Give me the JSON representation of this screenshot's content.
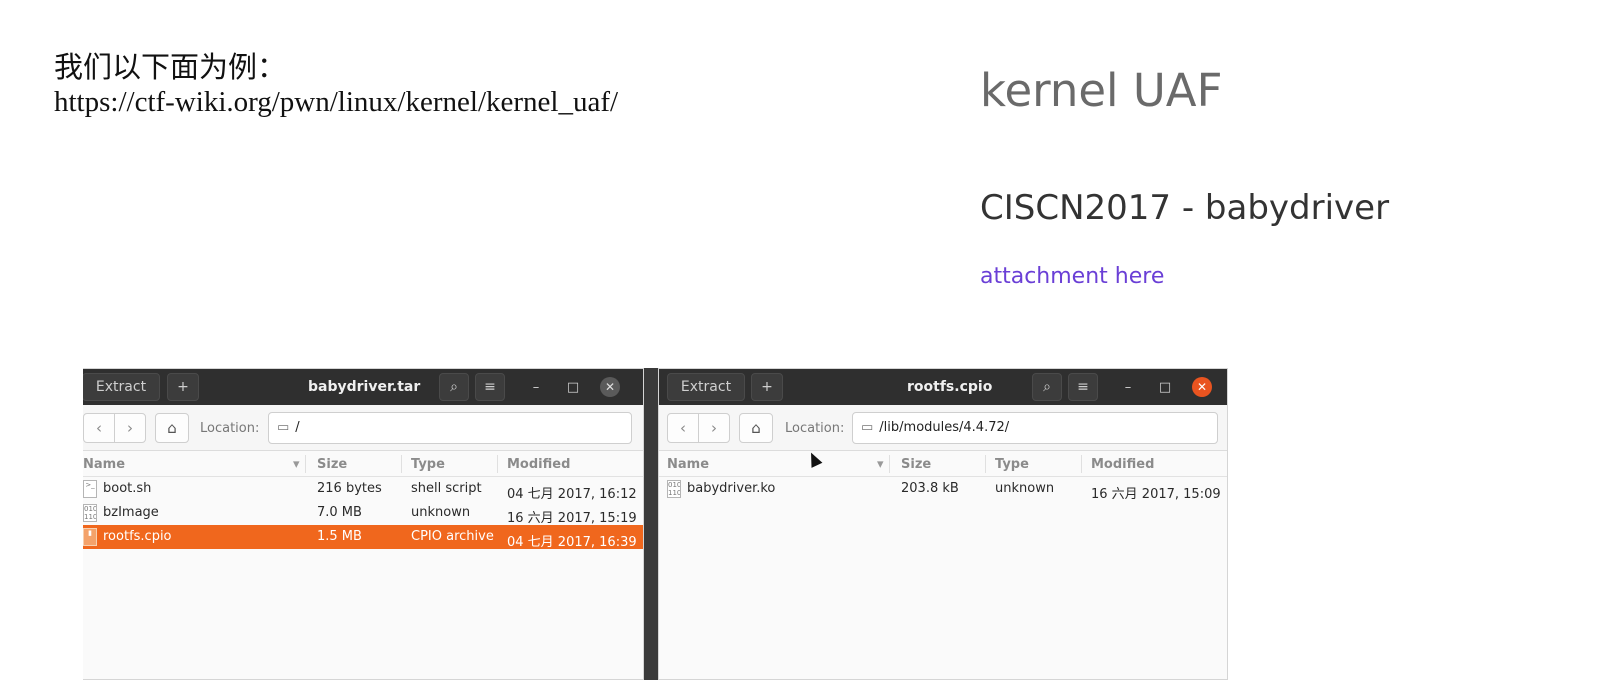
{
  "slide": {
    "heading": "我们以下面为例：",
    "url": "https://ctf-wiki.org/pwn/linux/kernel/kernel_uaf/"
  },
  "reference": {
    "title": "kernel UAF",
    "subtitle": "CISCN2017 - babydriver",
    "link": "attachment here",
    "link_color": "#6a3fd6"
  },
  "windows": {
    "left": {
      "extract_label": "Extract",
      "add_label": "+",
      "title": "babydriver.tar",
      "location_label": "Location:",
      "location_value": "/",
      "columns": {
        "name": "Name",
        "size": "Size",
        "type": "Type",
        "modified": "Modified"
      },
      "files": [
        {
          "name": "boot.sh",
          "size": "216 bytes",
          "type": "shell script",
          "modified": "04 七月 2017, 16:12"
        },
        {
          "name": "bzImage",
          "size": "7.0 MB",
          "type": "unknown",
          "modified": "16 六月 2017, 15:19"
        },
        {
          "name": "rootfs.cpio",
          "size": "1.5 MB",
          "type": "CPIO archive",
          "modified": "04 七月 2017, 16:39",
          "selected": true
        }
      ],
      "close_color": "#5a5a5a"
    },
    "right": {
      "extract_label": "Extract",
      "add_label": "+",
      "title": "rootfs.cpio",
      "location_label": "Location:",
      "location_value": "/lib/modules/4.4.72/",
      "columns": {
        "name": "Name",
        "size": "Size",
        "type": "Type",
        "modified": "Modified"
      },
      "files": [
        {
          "name": "babydriver.ko",
          "size": "203.8 kB",
          "type": "unknown",
          "modified": "16 六月 2017, 15:09"
        }
      ],
      "close_color": "#e95420"
    },
    "accent_selected": "#f0671d",
    "titlebar_color": "#2f2f2f"
  }
}
